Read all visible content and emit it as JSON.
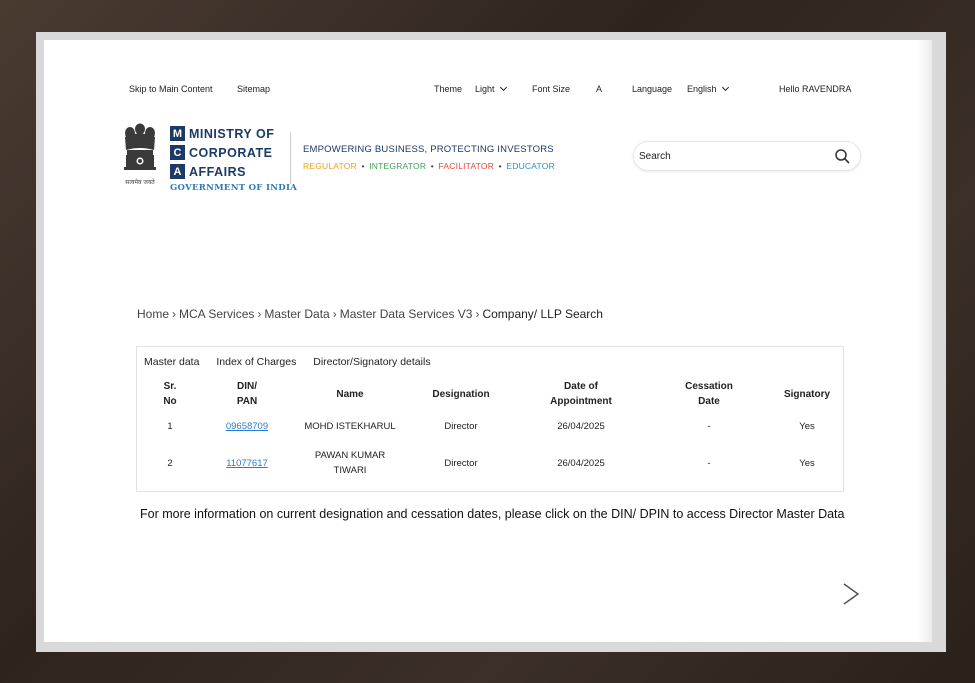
{
  "utility": {
    "skip": "Skip to Main Content",
    "sitemap": "Sitemap",
    "theme_label": "Theme",
    "theme_value": "Light",
    "font_size_label": "Font Size",
    "font_size_value": "A",
    "language_label": "Language",
    "language_value": "English",
    "greeting": "Hello RAVENDRA"
  },
  "brand": {
    "emblem_caption": "सत्यमेव जयते",
    "letters": [
      "M",
      "C",
      "A"
    ],
    "words": [
      "MINISTRY OF",
      "CORPORATE",
      "AFFAIRS"
    ],
    "government": "GOVERNMENT OF INDIA",
    "tagline": "EMPOWERING BUSINESS, PROTECTING INVESTORS",
    "roles": [
      {
        "label": "REGULATOR",
        "color": "#e8a317"
      },
      {
        "label": "INTEGRATOR",
        "color": "#3aa655"
      },
      {
        "label": "FACILITATOR",
        "color": "#e04b3a"
      },
      {
        "label": "EDUCATOR",
        "color": "#2f8fd1"
      }
    ],
    "role_separator": "•"
  },
  "search": {
    "placeholder": "Search",
    "icon": "search-icon"
  },
  "breadcrumb": {
    "items": [
      "Home",
      "MCA Services",
      "Master Data",
      "Master Data Services V3"
    ],
    "current": "Company/ LLP Search",
    "separator": "›"
  },
  "tabs": [
    "Master data",
    "Index of Charges",
    "Director/Signatory details"
  ],
  "table": {
    "headers": {
      "sr": [
        "Sr.",
        "No"
      ],
      "din": [
        "DIN/",
        "PAN"
      ],
      "name": "Name",
      "designation": "Designation",
      "appointment": [
        "Date of",
        "Appointment"
      ],
      "cessation": [
        "Cessation",
        "Date"
      ],
      "signatory": "Signatory"
    },
    "rows": [
      {
        "sr": "1",
        "din": "09658709",
        "name": [
          "MOHD ISTEKHARUL"
        ],
        "designation": "Director",
        "appointment": "26/04/2025",
        "cessation": "-",
        "signatory": "Yes"
      },
      {
        "sr": "2",
        "din": "11077617",
        "name": [
          "PAWAN KUMAR",
          "TIWARI"
        ],
        "designation": "Director",
        "appointment": "26/04/2025",
        "cessation": "-",
        "signatory": "Yes"
      }
    ]
  },
  "info_text": "For more information on current designation and cessation dates, please click on the DIN/ DPIN to access Director Master Data",
  "next_icon": "chevron-right-icon"
}
